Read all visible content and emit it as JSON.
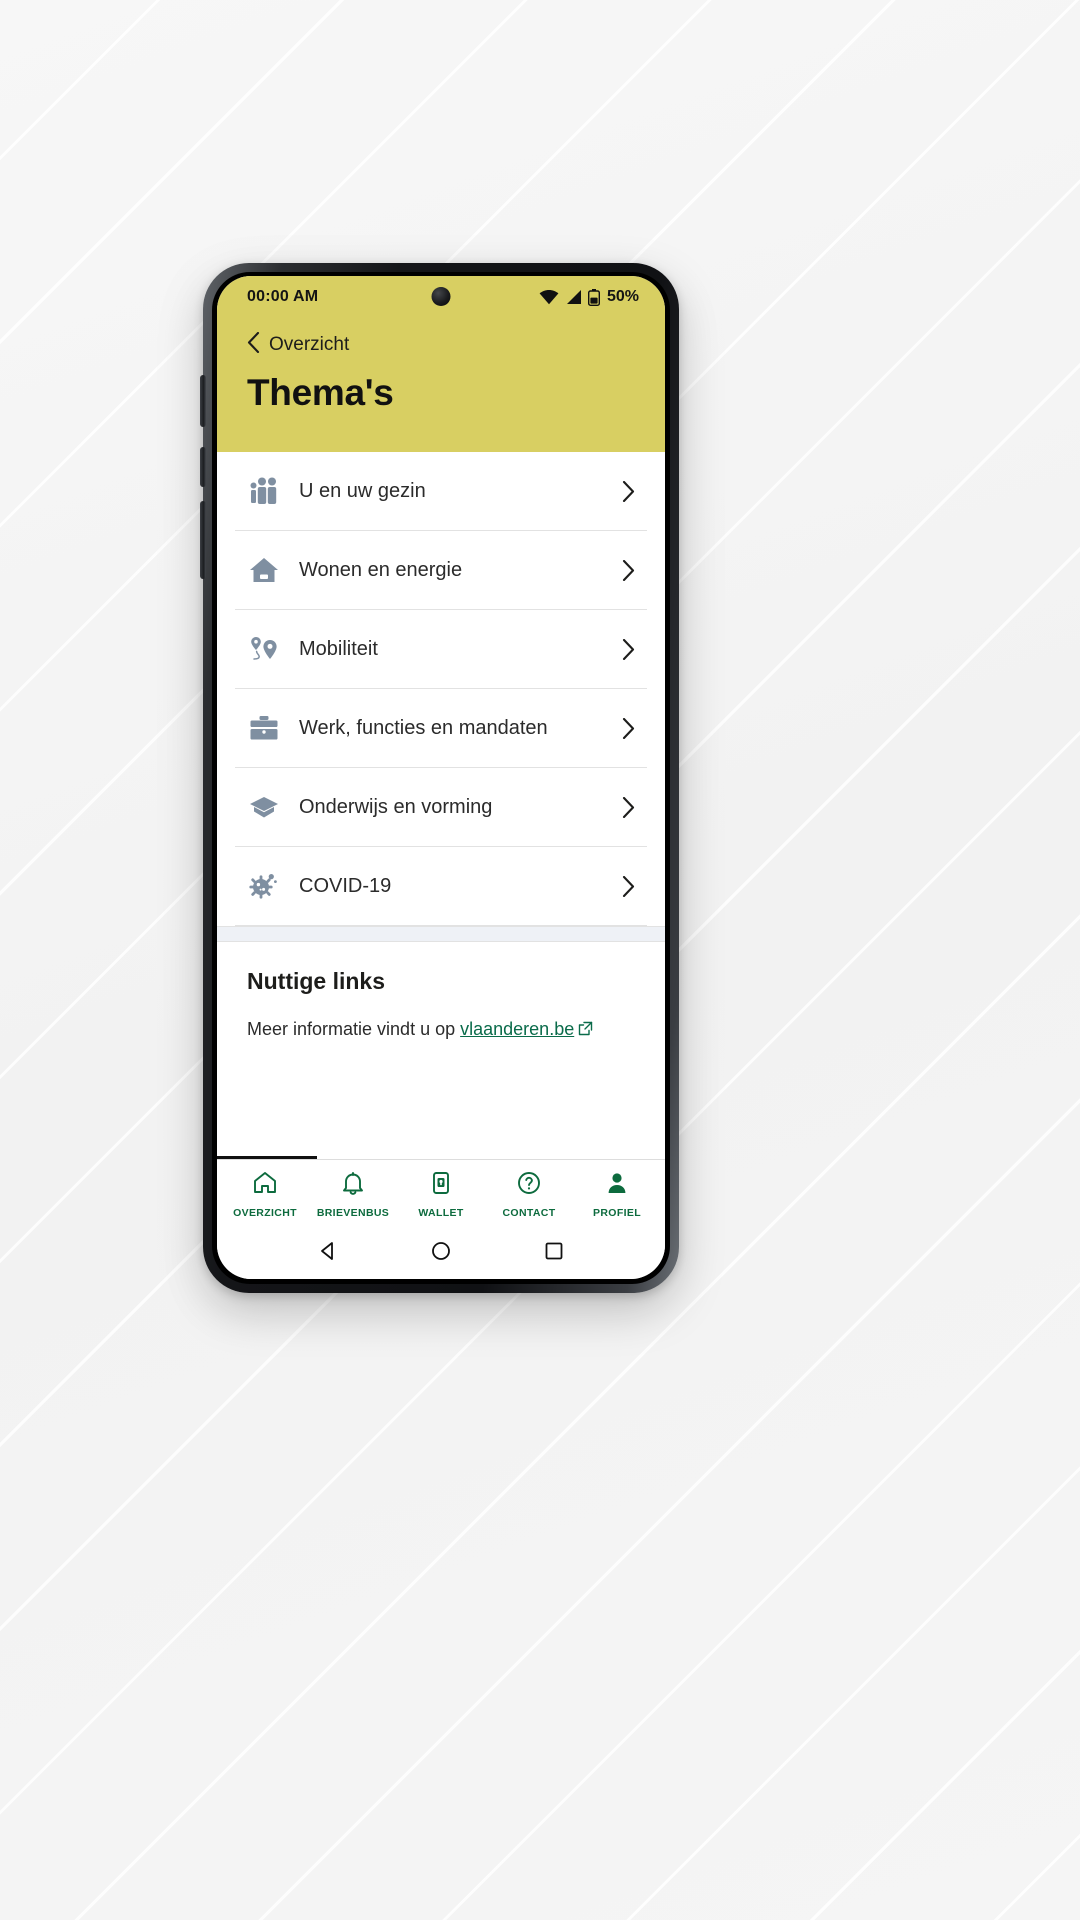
{
  "status_bar": {
    "time": "00:00 AM",
    "battery_percent": "50%",
    "icons": [
      "wifi-icon",
      "cellular-signal-icon",
      "battery-icon"
    ]
  },
  "header": {
    "back_label": "Overzicht",
    "back_icon": "chevron-left-icon",
    "title": "Thema's",
    "background_color": "#d8cf62"
  },
  "themes": [
    {
      "label": "U en uw gezin",
      "icon": "family-icon"
    },
    {
      "label": "Wonen en energie",
      "icon": "house-icon"
    },
    {
      "label": "Mobiliteit",
      "icon": "map-route-pin-icon"
    },
    {
      "label": "Werk, functies en mandaten",
      "icon": "briefcase-icon"
    },
    {
      "label": "Onderwijs en vorming",
      "icon": "graduation-cap-icon"
    },
    {
      "label": "COVID-19",
      "icon": "virus-icon"
    }
  ],
  "useful_links": {
    "title": "Nuttige links",
    "text_before": "Meer informatie vindt u op",
    "link_label": "vlaanderen.be",
    "link_icon": "external-link-icon"
  },
  "bottom_nav": [
    {
      "label": "OVERZICHT",
      "icon": "home-icon"
    },
    {
      "label": "BRIEVENBUS",
      "icon": "bell-icon"
    },
    {
      "label": "WALLET",
      "icon": "wallet-icon"
    },
    {
      "label": "CONTACT",
      "icon": "question-circle-icon"
    },
    {
      "label": "PROFIEL",
      "icon": "person-icon"
    }
  ],
  "android_nav": {
    "back": "back-triangle-icon",
    "home": "home-circle-icon",
    "recents": "recents-square-icon"
  },
  "colors": {
    "header_yellow": "#d8cf62",
    "nav_green": "#0d6b3e",
    "icon_slate": "#7f8fa1",
    "link_green": "#0a6b4a"
  }
}
